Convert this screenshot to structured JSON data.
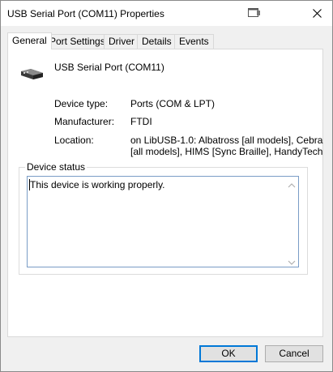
{
  "window": {
    "title": "USB Serial Port (COM11) Properties"
  },
  "tabs": [
    {
      "label": "General",
      "active": true
    },
    {
      "label": "Port Settings",
      "active": false
    },
    {
      "label": "Driver",
      "active": false
    },
    {
      "label": "Details",
      "active": false
    },
    {
      "label": "Events",
      "active": false
    }
  ],
  "general": {
    "device_name": "USB Serial Port (COM11)",
    "device_type_label": "Device type:",
    "device_type_value": "Ports (COM & LPT)",
    "manufacturer_label": "Manufacturer:",
    "manufacturer_value": "FTDI",
    "location_label": "Location:",
    "location_line1": "on LibUSB-1.0: Albatross [all models], Cebra",
    "location_line2": "[all models], HIMS [Sync Braille], HandyTech",
    "status_group_label": "Device status",
    "status_text": "This device is working properly."
  },
  "buttons": {
    "ok": "OK",
    "cancel": "Cancel"
  },
  "colors": {
    "accent": "#0078d7",
    "status_border": "#7a9cc6"
  },
  "icons": {
    "title": "properties-window-icon",
    "close": "close-icon",
    "device": "serial-port-device-icon"
  }
}
